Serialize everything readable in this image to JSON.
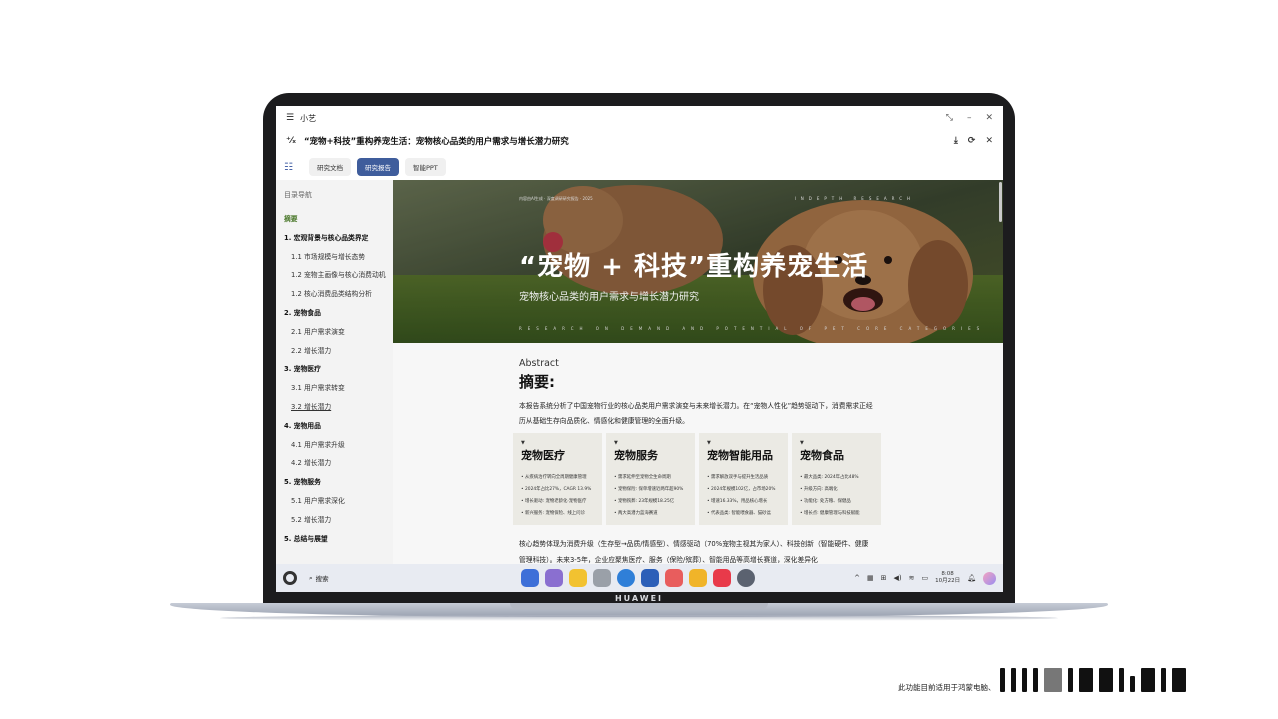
{
  "window": {
    "app_name": "小艺",
    "doc_title": "“宠物+科技”重构养宠生活：宠物核心品类的用户需求与增长潜力研究"
  },
  "tabs": [
    {
      "label": "研究文档",
      "active": false
    },
    {
      "label": "研究报告",
      "active": true
    },
    {
      "label": "智能PPT",
      "active": false
    }
  ],
  "sidebar": {
    "title": "目录导航",
    "items": [
      {
        "label": "摘要",
        "level": "summary"
      },
      {
        "label": "1. 宏观背景与核心品类界定",
        "level": "h1"
      },
      {
        "label": "1.1 市场规模与增长态势",
        "level": "h2"
      },
      {
        "label": "1.2 宠物主画像与核心消费动机",
        "level": "h2"
      },
      {
        "label": "1.2 核心消费品类结构分析",
        "level": "h2"
      },
      {
        "label": "2. 宠物食品",
        "level": "h1"
      },
      {
        "label": "2.1 用户需求演变",
        "level": "h2"
      },
      {
        "label": "2.2 增长潜力",
        "level": "h2"
      },
      {
        "label": "3. 宠物医疗",
        "level": "h1"
      },
      {
        "label": "3.1 用户需求转变",
        "level": "h2"
      },
      {
        "label": "3.2 增长潜力",
        "level": "h2",
        "underline": true
      },
      {
        "label": "4. 宠物用品",
        "level": "h1"
      },
      {
        "label": "4.1 用户需求升级",
        "level": "h2"
      },
      {
        "label": "4.2 增长潜力",
        "level": "h2"
      },
      {
        "label": "5. 宠物服务",
        "level": "h1"
      },
      {
        "label": "5.1 用户需求深化",
        "level": "h2"
      },
      {
        "label": "5.2 增长潜力",
        "level": "h2"
      },
      {
        "label": "5. 总结与展望",
        "level": "h1"
      }
    ]
  },
  "hero": {
    "meta": "内容由AI生成 · 深度调研研究报告 · 2025",
    "tag": "INDEPTH RESEARCH",
    "title": "“宠物 + 科技”重构养宠生活",
    "subtitle": "宠物核心品类的用户需求与增长潜力研究",
    "english": "RESEARCH ON DEMAND AND POTENTIAL OF PET CORE CATEGORIES"
  },
  "abstract": {
    "en": "Abstract",
    "zh": "摘要:",
    "paragraph": "本报告系统分析了中国宠物行业的核心品类用户需求演变与未来增长潜力。在“宠物人性化”趋势驱动下，消费需求正经历从基础生存向品质化、情感化和健康管理的全面升级。",
    "paragraph2": "核心趋势体现为消费升级（生存型→品质/情感型）、情感驱动（70%宠物主视其为家人）、科技创新（智能硬件、健康管理科技）。未来3-5年，企业应聚焦医疗、服务（保险/殡葬）、智能用品等高增长赛道，深化差异化"
  },
  "cards": [
    {
      "title": "宠物医疗",
      "items": [
        "从疾病治疗转向全周期健康管理",
        "2024年占比27%，CAGR 13.9%",
        "增长驱动: 宠物老龄化·宠物医疗",
        "新兴服务: 宠物保险、线上问诊"
      ]
    },
    {
      "title": "宠物服务",
      "items": [
        "需求延伸至宠物全生命周期",
        "宠物保险: 保单增速近两年超90%",
        "宠物殡葬: 23年规模18.25亿",
        "两大高潜力蓝海赛道"
      ]
    },
    {
      "title": "宠物智能用品",
      "items": [
        "需求解放双手与提升生活品质",
        "2024年规模102亿，占市场20%",
        "增速16.33%，用品核心增长",
        "代表品类: 智能喂食器、猫砂盆"
      ]
    },
    {
      "title": "宠物食品",
      "items": [
        "最大品类: 2024年占比48%",
        "升级方向: 高端化",
        "功能化: 处方粮、保健品",
        "增长点: 健康管理与科技赋能"
      ]
    }
  ],
  "taskbar": {
    "search_label": "搜索",
    "time": "8:08",
    "date": "10月22日",
    "apps": [
      {
        "name": "app-grid-icon",
        "color": "#3d6fd8"
      },
      {
        "name": "gallery-icon",
        "color": "#8a6fd0"
      },
      {
        "name": "files-icon",
        "color": "#f2c230"
      },
      {
        "name": "trash-icon",
        "color": "#9aa0a8"
      },
      {
        "name": "browser-icon",
        "color": "#2f7fd8"
      },
      {
        "name": "mail-icon",
        "color": "#2c5fb8"
      },
      {
        "name": "photos-icon",
        "color": "#e85d5d"
      },
      {
        "name": "notes-icon",
        "color": "#f0b429"
      },
      {
        "name": "appgallery-icon",
        "color": "#e83a4a"
      },
      {
        "name": "settings-icon",
        "color": "#5b6270"
      }
    ]
  },
  "laptop": {
    "brand": "HUAWEI"
  },
  "footnote": "此功能目前适用于鸿蒙电脑、"
}
